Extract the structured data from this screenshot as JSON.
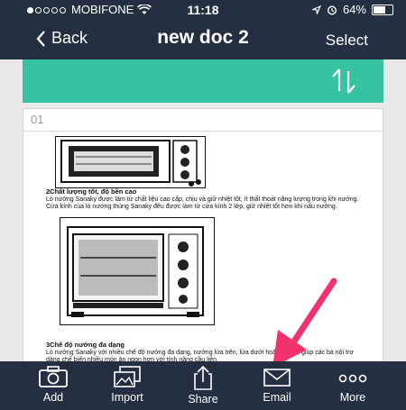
{
  "status": {
    "carrier": "MOBIFONE",
    "time": "11:18",
    "battery": "64%",
    "battery_level": 0.64
  },
  "nav": {
    "back_label": "Back",
    "title": "new doc 2",
    "select_label": "Select"
  },
  "page": {
    "number": "01",
    "content_lines": [
      "2Chất lượng tốt, độ bền cao",
      "Lò nướng Sanaky được làm từ chất liệu cao cấp, chịu và giữ nhiệt tốt, ít thất thoát năng lượng trong khi nướng.",
      "Cửa kính của lò nướng thùng Sanaky đều được làm từ cửa kính 2 lớp, giữ nhiệt tốt hơn khi nấu nướng.",
      "3Chế độ nướng đa dạng",
      "Lò nướng Sanaky với nhiều chế độ nướng đa dạng, nướng lửa trên, lửa dưới hoặc cả hai, giúp các bà nội trợ",
      "dàng chế biến nhiều món ăn ngon hơn với tính năng cầu liên"
    ]
  },
  "tabs": [
    {
      "label": "Add",
      "icon": "camera-icon"
    },
    {
      "label": "Import",
      "icon": "images-icon"
    },
    {
      "label": "Share",
      "icon": "share-icon"
    },
    {
      "label": "Email",
      "icon": "mail-icon"
    },
    {
      "label": "More",
      "icon": "more-icon"
    }
  ],
  "colors": {
    "bar": "#243041",
    "accent": "#36c3a1",
    "annotation_arrow": "#f0336c"
  }
}
